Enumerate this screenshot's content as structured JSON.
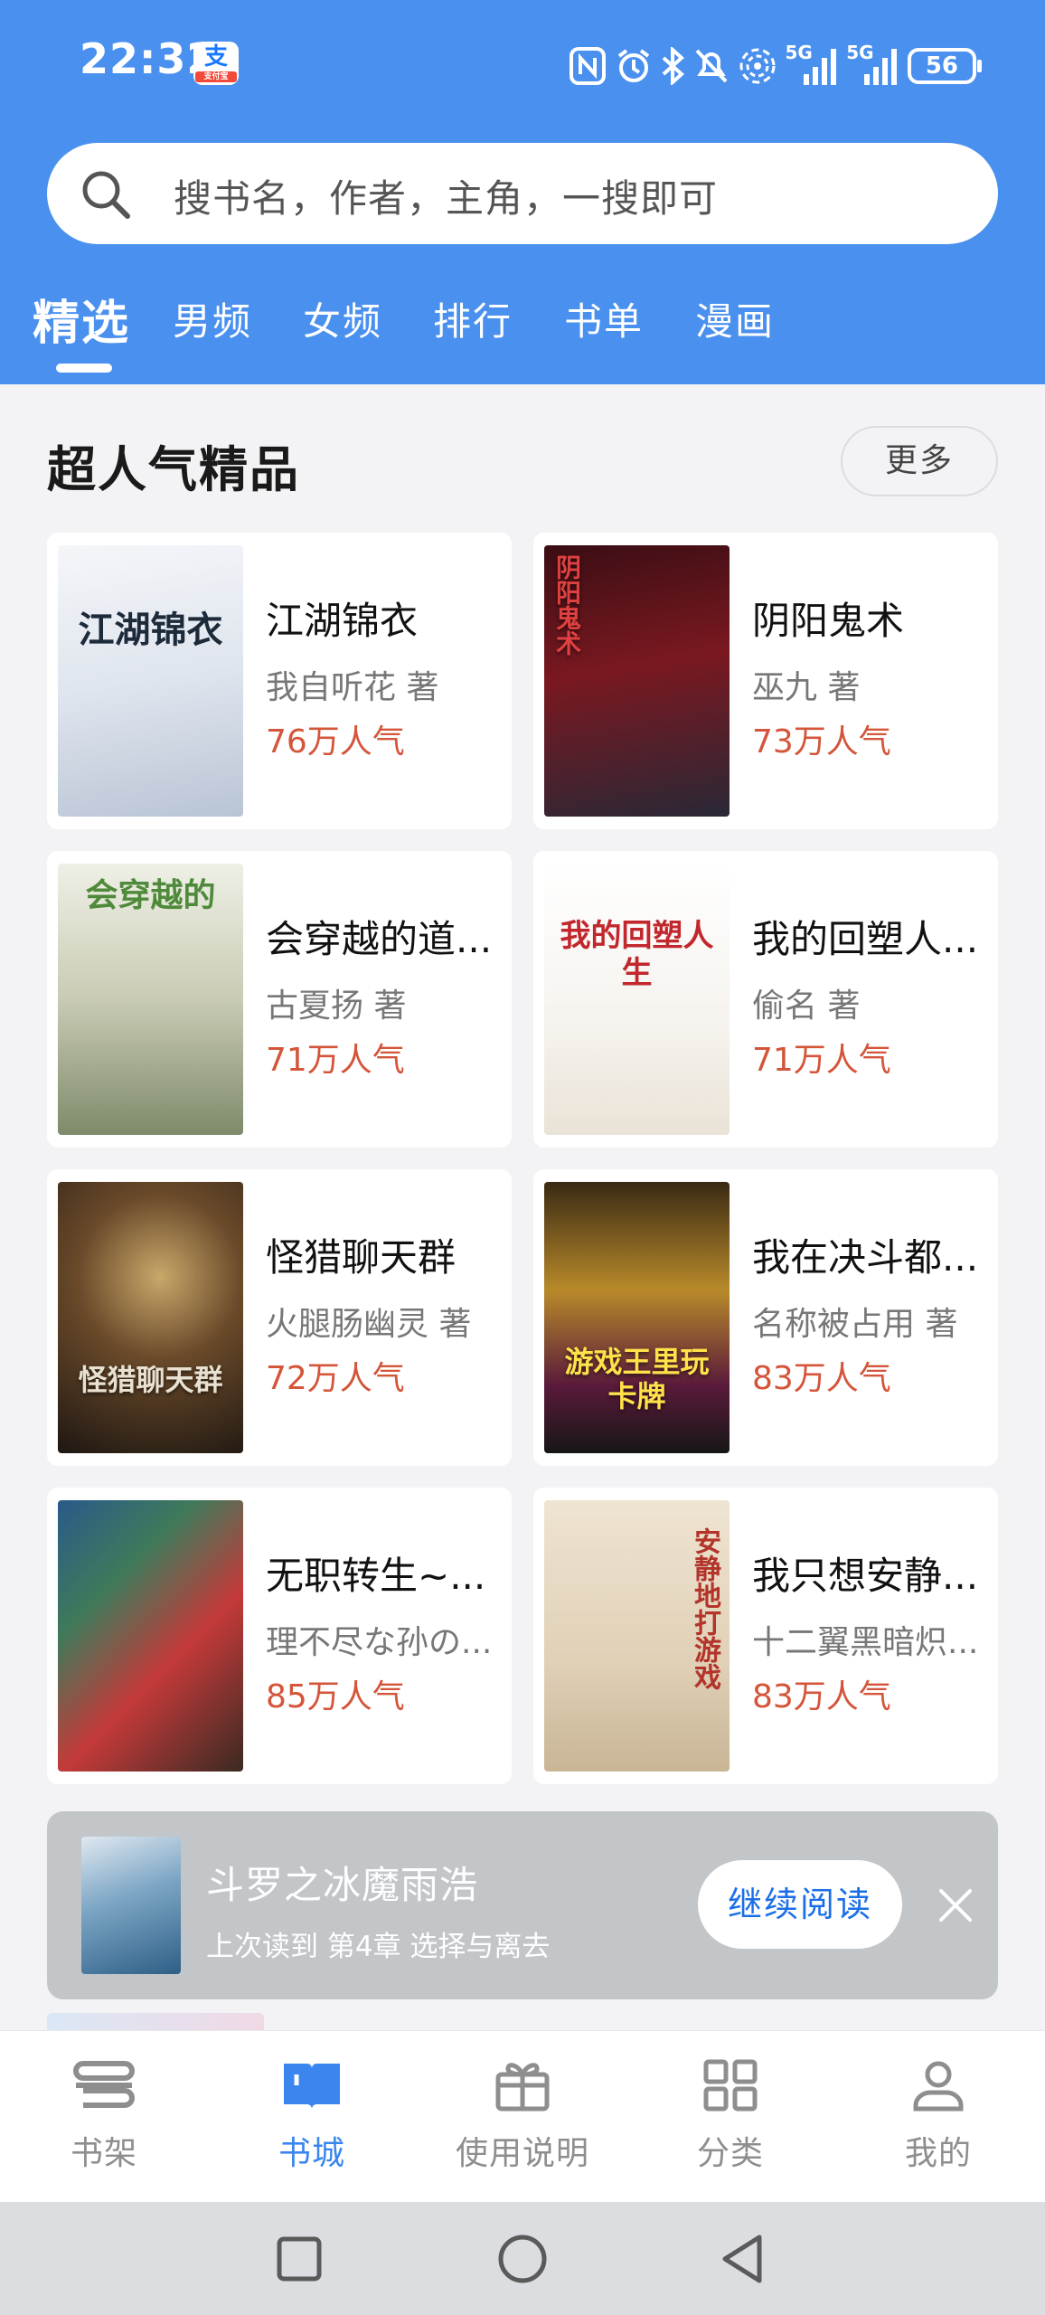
{
  "status_bar": {
    "time": "22:32",
    "alipay_badge": "支",
    "alipay_sub": "支付宝",
    "signal_1": "5G",
    "signal_2": "5G",
    "battery": "56",
    "icons": [
      "nfc-icon",
      "alarm-icon",
      "bluetooth-icon",
      "mute-icon",
      "hotspot-icon",
      "signal-icon",
      "signal-icon",
      "battery-icon"
    ]
  },
  "search": {
    "placeholder": "搜书名，作者，主角，一搜即可"
  },
  "tabs": [
    {
      "label": "精选",
      "active": true
    },
    {
      "label": "男频"
    },
    {
      "label": "女频"
    },
    {
      "label": "排行"
    },
    {
      "label": "书单"
    },
    {
      "label": "漫画"
    }
  ],
  "section": {
    "title": "超人气精品",
    "more_label": "更多"
  },
  "books": [
    {
      "title": "江湖锦衣",
      "author": "我自听花 著",
      "popularity": "76万人气",
      "cover_text": "江湖锦衣"
    },
    {
      "title": "阴阳鬼术",
      "author": "巫九 著",
      "popularity": "73万人气",
      "cover_text": "阴阳鬼术"
    },
    {
      "title": "会穿越的道...",
      "author": "古夏扬 著",
      "popularity": "71万人气",
      "cover_text": "会穿越的"
    },
    {
      "title": "我的回塑人...",
      "author": "偷名 著",
      "popularity": "71万人气",
      "cover_text": "我的回塑人生"
    },
    {
      "title": "怪猎聊天群",
      "author": "火腿肠幽灵 著",
      "popularity": "72万人气",
      "cover_text": "怪猎聊天群"
    },
    {
      "title": "我在决斗都...",
      "author": "名称被占用 著",
      "popularity": "83万人气",
      "cover_text": "游戏王里玩卡牌"
    },
    {
      "title": "无职转生~...",
      "author": "理不尽な孙の...",
      "popularity": "85万人气",
      "cover_text": ""
    },
    {
      "title": "我只想安静...",
      "author": "十二翼黑暗炽...",
      "popularity": "83万人气",
      "cover_text": "安静地打游戏"
    }
  ],
  "resume_banner": {
    "title": "斗罗之冰魔雨浩",
    "subtitle": "上次读到 第4章 选择与离去",
    "button_label": "继续阅读"
  },
  "bottom_nav": [
    {
      "label": "书架",
      "icon": "bookshelf-icon"
    },
    {
      "label": "书城",
      "icon": "book-open-icon",
      "active": true
    },
    {
      "label": "使用说明",
      "icon": "gift-icon"
    },
    {
      "label": "分类",
      "icon": "grid-icon"
    },
    {
      "label": "我的",
      "icon": "person-icon"
    }
  ],
  "colors": {
    "header_blue": "#4a90ef",
    "popularity_red": "#d4553a",
    "active_blue": "#3a86ee"
  }
}
